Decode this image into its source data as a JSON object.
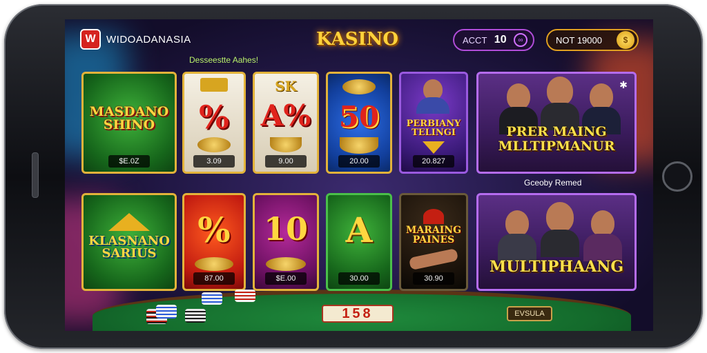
{
  "header": {
    "brand_name": "WIDOADANASIA",
    "brand_logo_glyph": "W",
    "logo_text": "KASINO",
    "account_label": "ACCT",
    "account_value": "10",
    "balance_label": "NOT 19000",
    "subheading": "Desseestte Aahes!"
  },
  "row1": [
    {
      "art": "MASDANO SHINO",
      "price": "$E.0Z"
    },
    {
      "art": "%",
      "price": "3.09"
    },
    {
      "art": "A%",
      "price": "9.00",
      "top": "SK"
    },
    {
      "art": "50",
      "price": "20.00"
    },
    {
      "art": "PERBIANY TELINGI",
      "price": "20.827"
    }
  ],
  "feature1": {
    "title": "PRER MAING MLLTIPMANUR"
  },
  "caption": "Gceoby Remed",
  "row2": [
    {
      "art": "KLASNANO SARIUS",
      "price": ""
    },
    {
      "art": "%",
      "price": "87.00"
    },
    {
      "art": "10",
      "price": "$E.00"
    },
    {
      "art": "A",
      "price": "30.00"
    },
    {
      "art": "MARAING PAINES",
      "price": "30.90"
    }
  ],
  "feature2": {
    "title": "MULTIPHAANG"
  },
  "bottom": {
    "counter": "158",
    "bet_button": "EVSULA"
  },
  "colors": {
    "accent_gold": "#e3b33a",
    "accent_purple": "#b56cf0",
    "table_green": "#1f8a3c"
  }
}
